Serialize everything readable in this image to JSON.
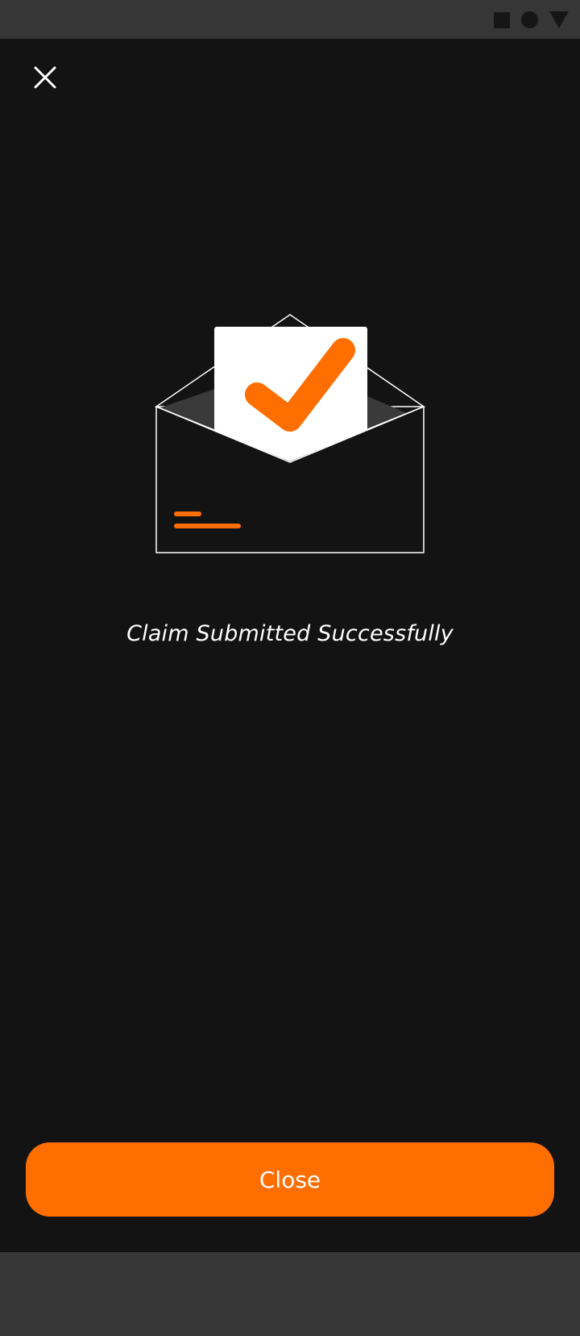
{
  "status_bar": {
    "icons": [
      "square-icon",
      "circle-icon",
      "triangle-icon"
    ]
  },
  "header": {
    "close_icon": "close-icon"
  },
  "illustration": {
    "name": "envelope-checkmark-illustration",
    "accent_color": "#ff6e00"
  },
  "message": {
    "text": "Claim Submitted Successfully"
  },
  "footer": {
    "close_label": "Close",
    "button_color": "#ff6e00"
  }
}
